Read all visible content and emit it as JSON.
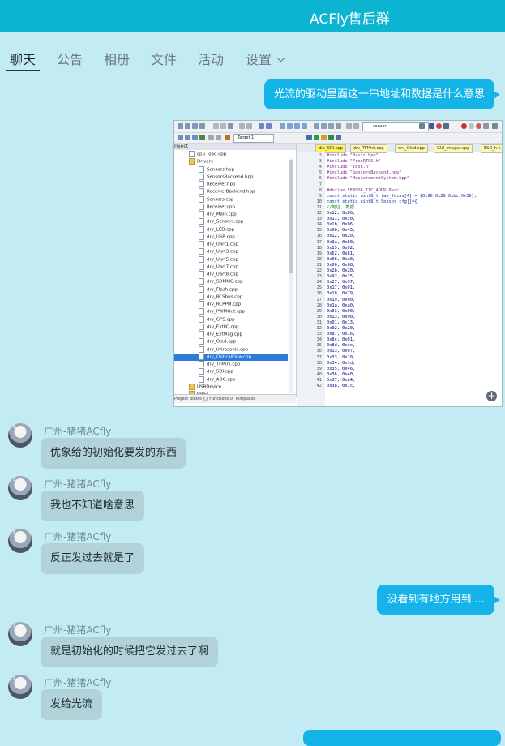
{
  "header": {
    "title": "ACFly售后群"
  },
  "tabs": [
    {
      "label": "聊天"
    },
    {
      "label": "公告"
    },
    {
      "label": "相册"
    },
    {
      "label": "文件"
    },
    {
      "label": "活动"
    },
    {
      "label": "设置"
    }
  ],
  "messages": {
    "m1": "光流的驱动里面这一串地址和数据是什么意思",
    "m2_sender": "广州-猪猪ACfly",
    "m2": "优象给的初始化要发的东西",
    "m3_sender": "广州-猪猪ACfly",
    "m3": "我也不知道啥意思",
    "m4_sender": "广州-猪猪ACfly",
    "m4": "反正发过去就是了",
    "m5": "没看到有地方用到....",
    "m6_sender": "广州-猪猪ACfly",
    "m6": "就是初始化的时候把它发过去了啊",
    "m7_sender": "广州-猪猪ACfly",
    "m7": "发给光流"
  },
  "screenshot": {
    "search_text": "sensor",
    "target": "Target 1",
    "project_title": "roject",
    "tree": [
      "cpu_load.cpp",
      "Drivers",
      "Sensors.hpp",
      "SensorsBackend.hpp",
      "Receiver.hpp",
      "ReceiverBackend.hpp",
      "Sensors.cpp",
      "Receiver.cpp",
      "drv_Main.cpp",
      "drv_Sensors.cpp",
      "drv_LED.cpp",
      "drv_USB.cpp",
      "drv_Uart1.cpp",
      "drv_Uart3.cpp",
      "drv_Uart5.cpp",
      "drv_Uart7.cpp",
      "drv_Uart8.cpp",
      "drv_SDMMC.cpp",
      "drv_Flash.cpp",
      "drv_RCSbus.cpp",
      "drv_RCPPM.cpp",
      "drv_PWMOut.cpp",
      "drv_GPS.cpp",
      "drv_ExtIIC.cpp",
      "drv_ExtMag.cpp",
      "drv_Oled.cpp",
      "drv_Ultrasonic.cpp",
      "drv_OpticalFlow.cpp",
      "drv_TFMini.cpp",
      "drv_SDI.cpp",
      "drv_ADC.cpp",
      "USBDevice",
      "FatFs"
    ],
    "proj_tabs": "Project  Books  {} Functions  0, Templates",
    "editor_tabs": [
      "drv_SDI.cpp",
      "drv_TFMini.cpp",
      "drv_Oled.cpp",
      "GUI_images.cpp",
      "ESO_h.h"
    ],
    "code": [
      {
        "n": "2",
        "t": "#include \"Basic.hpp\"",
        "c": "pre"
      },
      {
        "n": "3",
        "t": "#include \"FreeRTOS.h\"",
        "c": "pre"
      },
      {
        "n": "4",
        "t": "#include \"task.h\"",
        "c": "pre"
      },
      {
        "n": "5",
        "t": "#include \"SensorsBackend.hpp\"",
        "c": "pre"
      },
      {
        "n": "6",
        "t": "#include \"MeasurementSystem.hpp\"",
        "c": "pre"
      },
      {
        "n": "7",
        "t": "",
        "c": ""
      },
      {
        "n": "8",
        "t": "#define SENSOR_IIC_ADDR 0xdc",
        "c": "pre"
      },
      {
        "n": "9",
        "t": "const static uint8_t tab_focus[4] = {0x96,0x26,0xbc,0x50};",
        "c": "kw"
      },
      {
        "n": "10",
        "t": "const static uint8_t Sensor_cfg[]={",
        "c": "kw"
      },
      {
        "n": "11",
        "t": "//地址, 数据",
        "c": "cmt"
      },
      {
        "n": "12",
        "t": "0x12, 0x80,",
        "c": ""
      },
      {
        "n": "13",
        "t": "0x11, 0x30,",
        "c": ""
      },
      {
        "n": "14",
        "t": "0x1b, 0x06,",
        "c": ""
      },
      {
        "n": "15",
        "t": "0x6b, 0x43,",
        "c": ""
      },
      {
        "n": "16",
        "t": "0x12, 0x20,",
        "c": ""
      },
      {
        "n": "17",
        "t": "0x3a, 0x00,",
        "c": ""
      },
      {
        "n": "18",
        "t": "0x15, 0x02,",
        "c": ""
      },
      {
        "n": "19",
        "t": "0x62, 0x81,",
        "c": ""
      },
      {
        "n": "20",
        "t": "0x08, 0xa0,",
        "c": ""
      },
      {
        "n": "21",
        "t": "0x06, 0x68,",
        "c": ""
      },
      {
        "n": "22",
        "t": "0x2b, 0x20,",
        "c": ""
      },
      {
        "n": "23",
        "t": "0x92, 0x25,",
        "c": ""
      },
      {
        "n": "24",
        "t": "0x27, 0x97,",
        "c": ""
      },
      {
        "n": "25",
        "t": "0x17, 0x01,",
        "c": ""
      },
      {
        "n": "26",
        "t": "0x18, 0x79,",
        "c": ""
      },
      {
        "n": "27",
        "t": "0x19, 0x00,",
        "c": ""
      },
      {
        "n": "28",
        "t": "0x1a, 0xa0,",
        "c": ""
      },
      {
        "n": "29",
        "t": "0x03, 0x00,",
        "c": ""
      },
      {
        "n": "30",
        "t": "0x13, 0x00,",
        "c": ""
      },
      {
        "n": "31",
        "t": "0x01, 0x13,",
        "c": ""
      },
      {
        "n": "32",
        "t": "0x02, 0x20,",
        "c": ""
      },
      {
        "n": "33",
        "t": "0x87, 0x16,",
        "c": ""
      },
      {
        "n": "34",
        "t": "0x8c, 0x01,",
        "c": ""
      },
      {
        "n": "35",
        "t": "0x8d, 0xcc,",
        "c": ""
      },
      {
        "n": "36",
        "t": "0x13, 0x07,",
        "c": ""
      },
      {
        "n": "37",
        "t": "0x33, 0x10,",
        "c": ""
      },
      {
        "n": "38",
        "t": "0x34, 0x1d,",
        "c": ""
      },
      {
        "n": "39",
        "t": "0x35, 0x46,",
        "c": ""
      },
      {
        "n": "40",
        "t": "0x36, 0x40,",
        "c": ""
      },
      {
        "n": "41",
        "t": "0x37, 0xa4,",
        "c": ""
      },
      {
        "n": "42",
        "t": "0x38, 0x7c,",
        "c": ""
      }
    ]
  }
}
